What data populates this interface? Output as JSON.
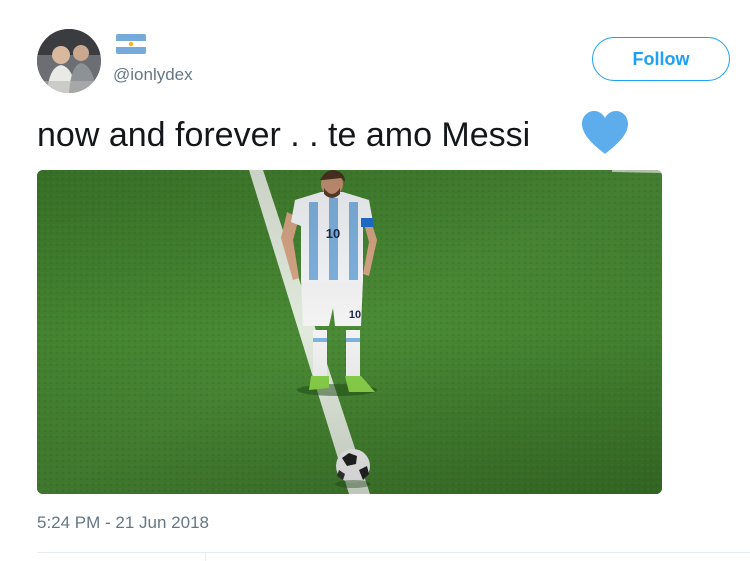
{
  "tweet": {
    "handle": "@ionlydex",
    "follow_label": "Follow",
    "text": "now and forever . . te amo Messi",
    "emoji": "blue-heart-icon",
    "timestamp": "5:24 PM - 21 Jun 2018"
  },
  "photo": {
    "jersey_number": "10"
  },
  "colors": {
    "accent": "#1da1f2",
    "secondary_text": "#657786",
    "heart": "#5dadec",
    "pitch": "#3f7a2c",
    "flag_blue": "#75aadb"
  }
}
